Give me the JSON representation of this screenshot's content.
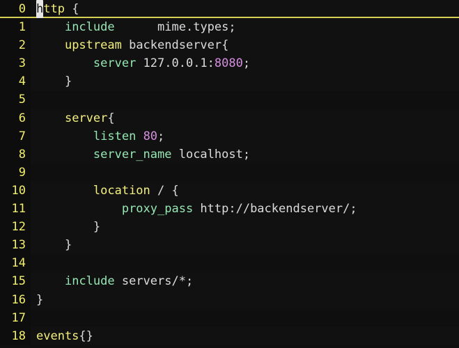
{
  "app": {
    "kind": "terminal-text-editor",
    "filename_shown": false
  },
  "theme": {
    "background": "#111112",
    "gutter_background": "#0d0d0e",
    "line_number_color": "#f2f06a",
    "default_text_color": "#d8d8d8",
    "keyword_color": "#f4f07d",
    "directive_color": "#96e6b3",
    "number_color": "#d68fe0",
    "cursor_background": "#e6e6e6",
    "cursor_text_color": "#101010",
    "current_line_underline": "#d6d154"
  },
  "cursor": {
    "line": 0,
    "column": 0,
    "character": "h"
  },
  "editor": {
    "lines": [
      {
        "number": "0",
        "current": true,
        "tokens": [
          {
            "text": "h",
            "cls": "kw",
            "cursor": true
          },
          {
            "text": "ttp",
            "cls": "kw"
          },
          {
            "text": " ",
            "cls": "pun"
          },
          {
            "text": "{",
            "cls": "pun"
          }
        ]
      },
      {
        "number": "1",
        "current": false,
        "tokens": [
          {
            "text": "    ",
            "cls": "pun"
          },
          {
            "text": "include",
            "cls": "dir"
          },
          {
            "text": "      ",
            "cls": "pun"
          },
          {
            "text": "mime.types;",
            "cls": "txt"
          }
        ]
      },
      {
        "number": "2",
        "current": false,
        "tokens": [
          {
            "text": "    ",
            "cls": "pun"
          },
          {
            "text": "upstream",
            "cls": "kw"
          },
          {
            "text": " backendserver{",
            "cls": "txt"
          }
        ]
      },
      {
        "number": "3",
        "current": false,
        "tokens": [
          {
            "text": "        ",
            "cls": "pun"
          },
          {
            "text": "server",
            "cls": "dir"
          },
          {
            "text": " 127.0.0.1:",
            "cls": "txt"
          },
          {
            "text": "8080",
            "cls": "num"
          },
          {
            "text": ";",
            "cls": "txt"
          }
        ]
      },
      {
        "number": "4",
        "current": false,
        "tokens": [
          {
            "text": "    ",
            "cls": "pun"
          },
          {
            "text": "}",
            "cls": "pun"
          }
        ]
      },
      {
        "number": "5",
        "current": false,
        "tokens": []
      },
      {
        "number": "6",
        "current": false,
        "tokens": [
          {
            "text": "    ",
            "cls": "pun"
          },
          {
            "text": "server",
            "cls": "kw"
          },
          {
            "text": "{",
            "cls": "pun"
          }
        ]
      },
      {
        "number": "7",
        "current": false,
        "tokens": [
          {
            "text": "        ",
            "cls": "pun"
          },
          {
            "text": "listen",
            "cls": "dir"
          },
          {
            "text": " ",
            "cls": "txt"
          },
          {
            "text": "80",
            "cls": "num"
          },
          {
            "text": ";",
            "cls": "txt"
          }
        ]
      },
      {
        "number": "8",
        "current": false,
        "tokens": [
          {
            "text": "        ",
            "cls": "pun"
          },
          {
            "text": "server_name",
            "cls": "dir"
          },
          {
            "text": " localhost;",
            "cls": "txt"
          }
        ]
      },
      {
        "number": "9",
        "current": false,
        "tokens": []
      },
      {
        "number": "10",
        "current": false,
        "tokens": [
          {
            "text": "        ",
            "cls": "pun"
          },
          {
            "text": "location",
            "cls": "kw"
          },
          {
            "text": " / {",
            "cls": "txt"
          }
        ]
      },
      {
        "number": "11",
        "current": false,
        "tokens": [
          {
            "text": "            ",
            "cls": "pun"
          },
          {
            "text": "proxy_pass",
            "cls": "dir"
          },
          {
            "text": " http://backendserver/;",
            "cls": "txt"
          }
        ]
      },
      {
        "number": "12",
        "current": false,
        "tokens": [
          {
            "text": "        ",
            "cls": "pun"
          },
          {
            "text": "}",
            "cls": "pun"
          }
        ]
      },
      {
        "number": "13",
        "current": false,
        "tokens": [
          {
            "text": "    ",
            "cls": "pun"
          },
          {
            "text": "}",
            "cls": "pun"
          }
        ]
      },
      {
        "number": "14",
        "current": false,
        "tokens": []
      },
      {
        "number": "15",
        "current": false,
        "tokens": [
          {
            "text": "    ",
            "cls": "pun"
          },
          {
            "text": "include",
            "cls": "dir"
          },
          {
            "text": " servers/*;",
            "cls": "txt"
          }
        ]
      },
      {
        "number": "16",
        "current": false,
        "tokens": [
          {
            "text": "}",
            "cls": "pun"
          }
        ]
      },
      {
        "number": "17",
        "current": false,
        "tokens": []
      },
      {
        "number": "18",
        "current": false,
        "tokens": [
          {
            "text": "events",
            "cls": "kw"
          },
          {
            "text": "{}",
            "cls": "pun"
          }
        ]
      }
    ]
  },
  "plain_text": {
    "0": "http {",
    "1": "    include       mime.types;",
    "2": "    upstream backendserver{",
    "3": "        server 127.0.0.1:8080;",
    "4": "    }",
    "5": "",
    "6": "    server{",
    "7": "        listen 80;",
    "8": "        server_name localhost;",
    "9": "",
    "10": "        location / {",
    "11": "            proxy_pass http://backendserver/;",
    "12": "        }",
    "13": "    }",
    "14": "",
    "15": "    include servers/*;",
    "16": "}",
    "17": "",
    "18": "events{}"
  }
}
